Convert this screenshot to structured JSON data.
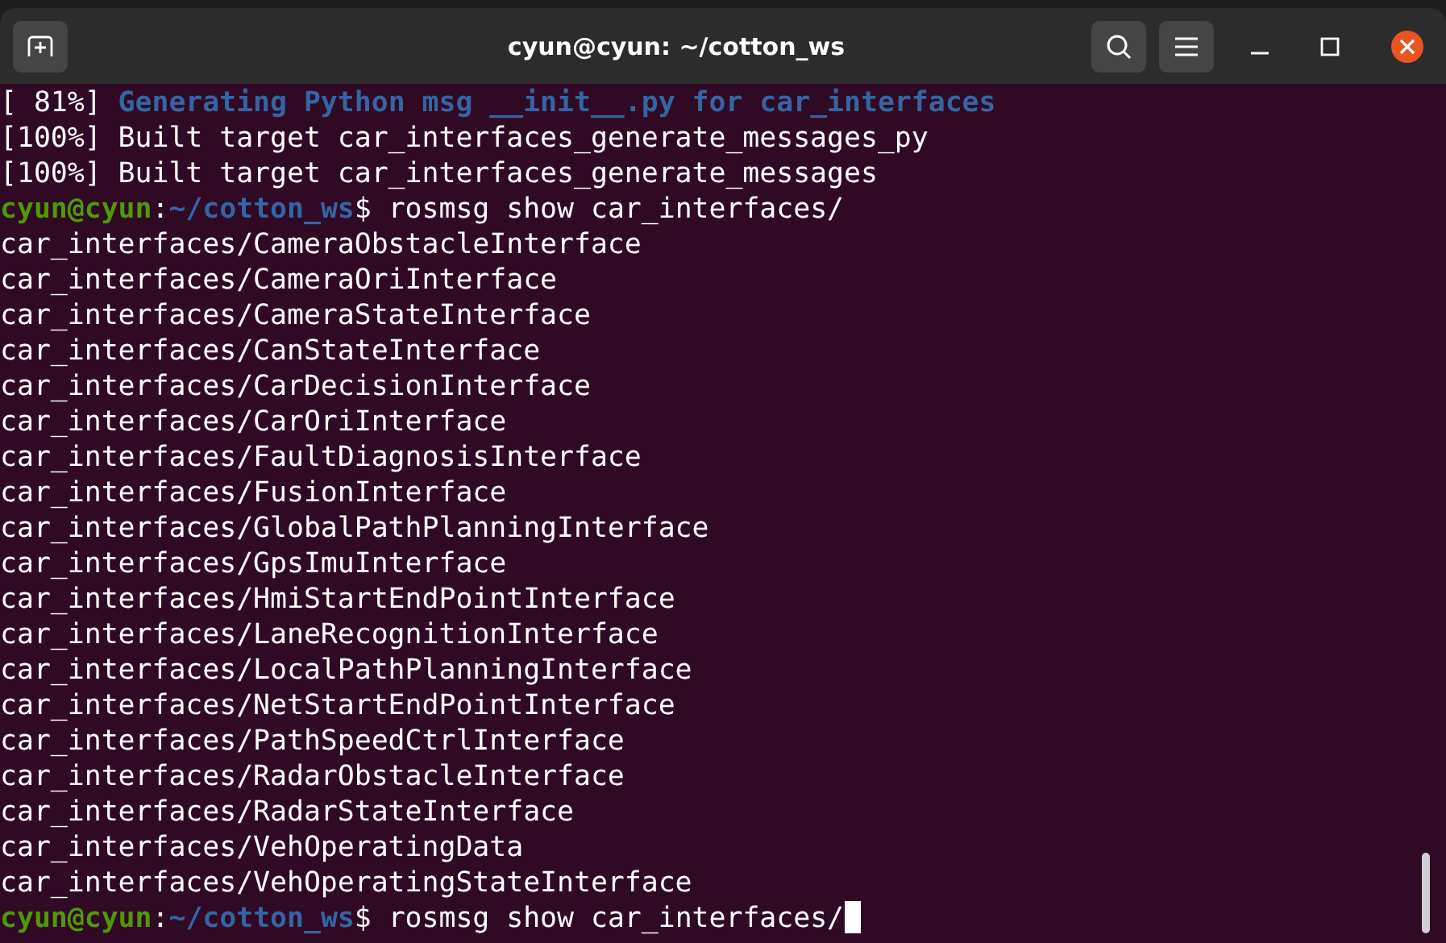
{
  "window": {
    "title": "cyun@cyun: ~/cotton_ws"
  },
  "lines": [
    {
      "kind": "progress",
      "percent": "[ 81%]",
      "text": "Generating Python msg __init__.py for car_interfaces"
    },
    {
      "kind": "output",
      "text": "[100%] Built target car_interfaces_generate_messages_py"
    },
    {
      "kind": "output",
      "text": "[100%] Built target car_interfaces_generate_messages"
    },
    {
      "kind": "prompt",
      "user": "cyun@cyun",
      "sep": ":",
      "path": "~/cotton_ws",
      "command": "$ rosmsg show car_interfaces/",
      "cursor": false
    },
    {
      "kind": "output",
      "text": "car_interfaces/CameraObstacleInterface"
    },
    {
      "kind": "output",
      "text": "car_interfaces/CameraOriInterface"
    },
    {
      "kind": "output",
      "text": "car_interfaces/CameraStateInterface"
    },
    {
      "kind": "output",
      "text": "car_interfaces/CanStateInterface"
    },
    {
      "kind": "output",
      "text": "car_interfaces/CarDecisionInterface"
    },
    {
      "kind": "output",
      "text": "car_interfaces/CarOriInterface"
    },
    {
      "kind": "output",
      "text": "car_interfaces/FaultDiagnosisInterface"
    },
    {
      "kind": "output",
      "text": "car_interfaces/FusionInterface"
    },
    {
      "kind": "output",
      "text": "car_interfaces/GlobalPathPlanningInterface"
    },
    {
      "kind": "output",
      "text": "car_interfaces/GpsImuInterface"
    },
    {
      "kind": "output",
      "text": "car_interfaces/HmiStartEndPointInterface"
    },
    {
      "kind": "output",
      "text": "car_interfaces/LaneRecognitionInterface"
    },
    {
      "kind": "output",
      "text": "car_interfaces/LocalPathPlanningInterface"
    },
    {
      "kind": "output",
      "text": "car_interfaces/NetStartEndPointInterface"
    },
    {
      "kind": "output",
      "text": "car_interfaces/PathSpeedCtrlInterface"
    },
    {
      "kind": "output",
      "text": "car_interfaces/RadarObstacleInterface"
    },
    {
      "kind": "output",
      "text": "car_interfaces/RadarStateInterface"
    },
    {
      "kind": "output",
      "text": "car_interfaces/VehOperatingData"
    },
    {
      "kind": "output",
      "text": "car_interfaces/VehOperatingStateInterface"
    },
    {
      "kind": "prompt",
      "user": "cyun@cyun",
      "sep": ":",
      "path": "~/cotton_ws",
      "command": "$ rosmsg show car_interfaces/",
      "cursor": true
    }
  ]
}
